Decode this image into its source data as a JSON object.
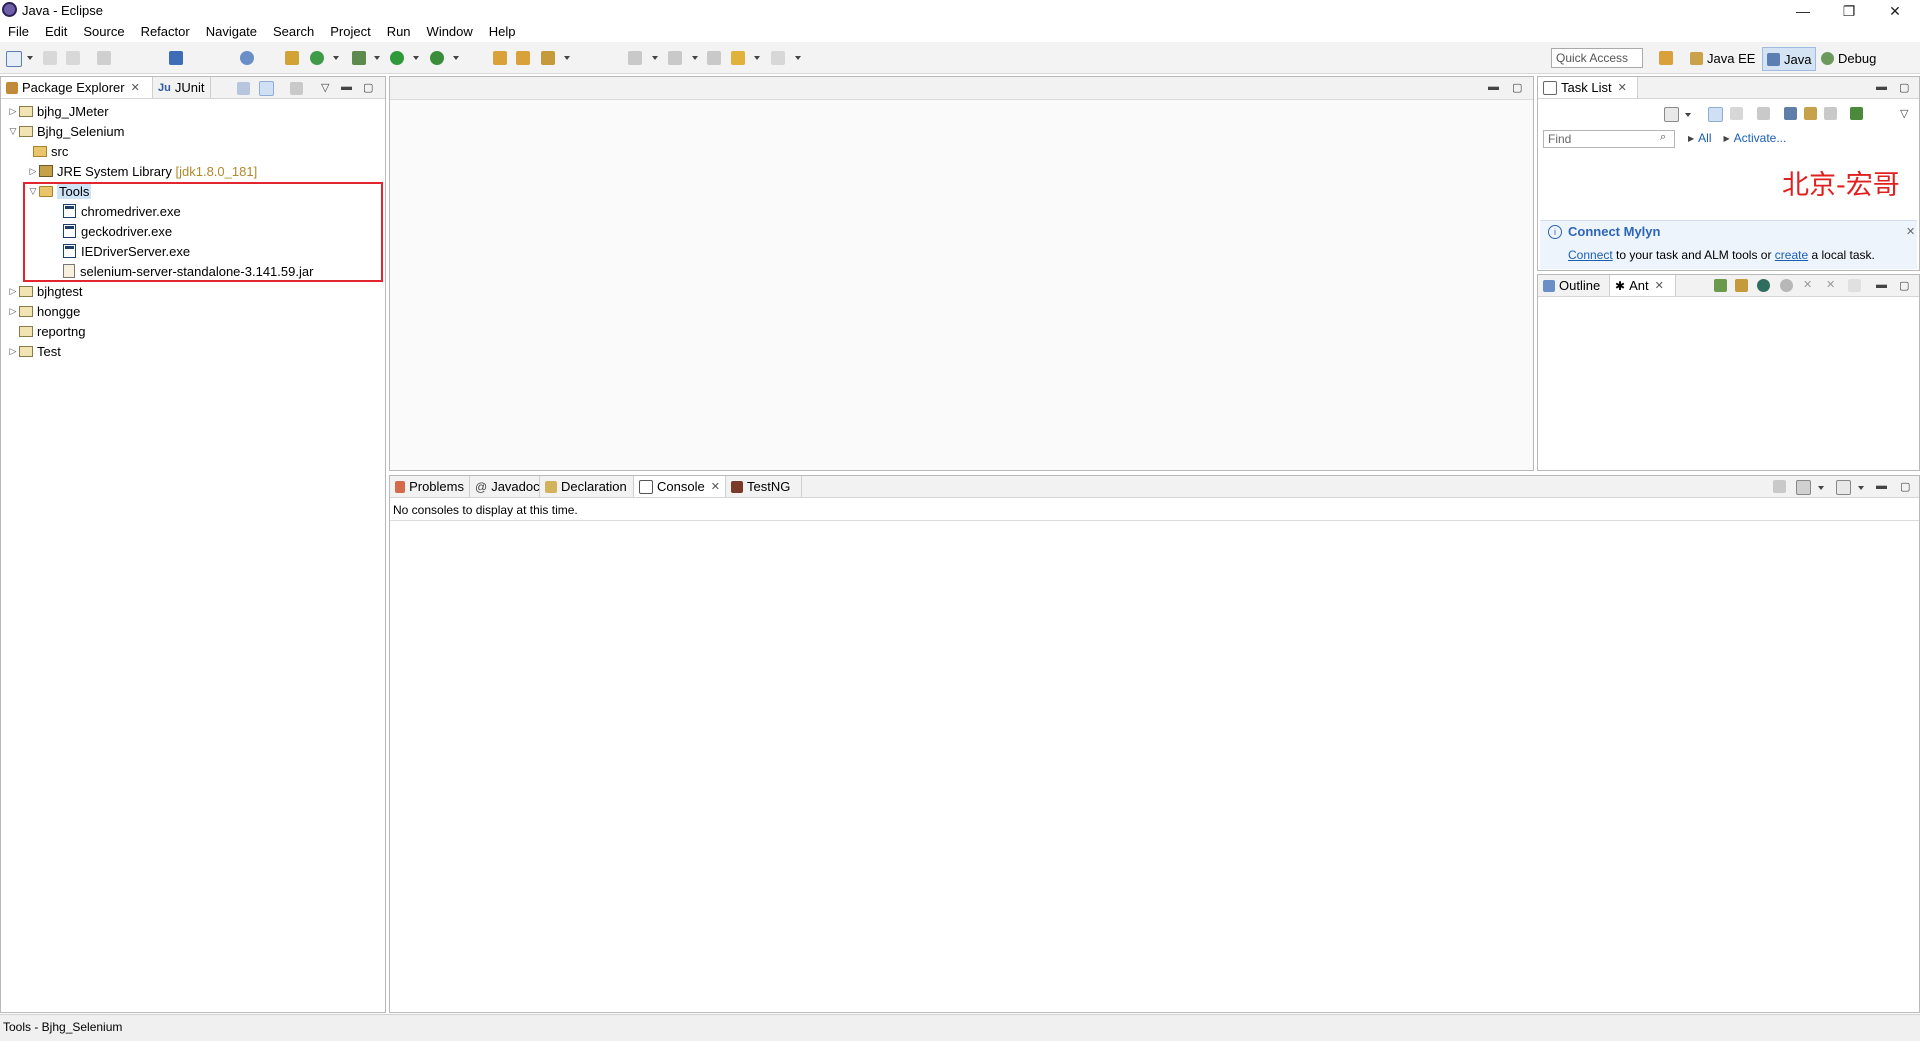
{
  "window": {
    "title": "Java - Eclipse",
    "minimize": "—",
    "restore": "❐",
    "close": "✕"
  },
  "menu": [
    "File",
    "Edit",
    "Source",
    "Refactor",
    "Navigate",
    "Search",
    "Project",
    "Run",
    "Window",
    "Help"
  ],
  "toolbar": {
    "quick_access": "Quick Access",
    "perspectives": [
      "Java EE",
      "Java",
      "Debug"
    ],
    "active_perspective": "Java"
  },
  "package_explorer": {
    "tabs": [
      "Package Explorer",
      "JUnit"
    ],
    "tree": [
      {
        "label": "bjhg_JMeter",
        "expanded": false
      },
      {
        "label": "Bjhg_Selenium",
        "expanded": true
      },
      {
        "label": "src"
      },
      {
        "label": "JRE System Library",
        "decoration": "[jdk1.8.0_181]",
        "expanded": false
      },
      {
        "label": "Tools",
        "expanded": true,
        "selected": true
      },
      {
        "label": "chromedriver.exe"
      },
      {
        "label": "geckodriver.exe"
      },
      {
        "label": "IEDriverServer.exe"
      },
      {
        "label": "selenium-server-standalone-3.141.59.jar"
      },
      {
        "label": "bjhgtest",
        "expanded": false
      },
      {
        "label": "hongge",
        "expanded": false
      },
      {
        "label": "reportng"
      },
      {
        "label": "Test",
        "expanded": false
      }
    ]
  },
  "task_list": {
    "tab": "Task List",
    "find_placeholder": "Find",
    "filter_all": "All",
    "activate": "Activate...",
    "watermark": "北京-宏哥",
    "mylyn": {
      "title": "Connect Mylyn",
      "link_connect": "Connect",
      "text_mid": " to your task and ALM tools or ",
      "link_create": "create",
      "text_end": " a local task."
    }
  },
  "outline": {
    "tabs": [
      "Outline",
      "Ant"
    ]
  },
  "bottom_panel": {
    "tabs": [
      "Problems",
      "Javadoc",
      "Declaration",
      "Console",
      "TestNG"
    ],
    "active_tab": "Console",
    "message": "No consoles to display at this time."
  },
  "status_bar": {
    "text": "Tools - Bjhg_Selenium"
  },
  "colors": {
    "highlight_box": "#e2252e",
    "watermark": "#e02020",
    "link": "#1a5fb4",
    "selection": "#cde3f7"
  }
}
